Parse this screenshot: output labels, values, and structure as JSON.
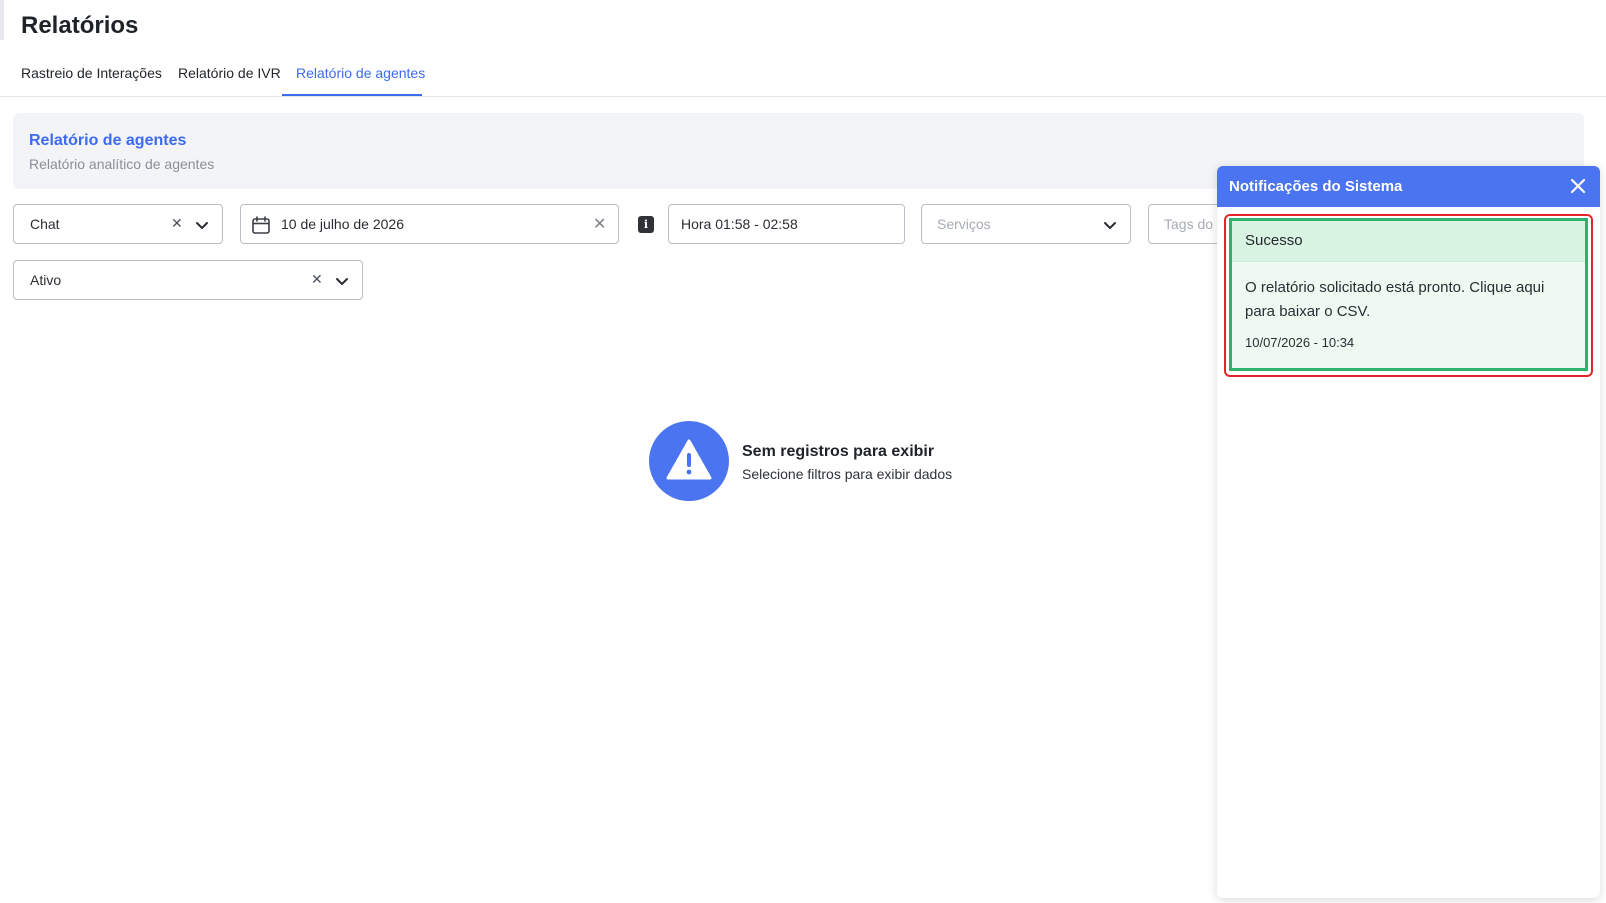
{
  "page": {
    "title": "Relatórios"
  },
  "tabs": [
    {
      "label": "Rastreio de Interações",
      "active": false
    },
    {
      "label": "Relatório de IVR",
      "active": false
    },
    {
      "label": "Relatório de agentes",
      "active": true
    }
  ],
  "banner": {
    "title": "Relatório de agentes",
    "subtitle": "Relatório analítico de agentes"
  },
  "filters": {
    "channel": {
      "value": "Chat"
    },
    "date": {
      "value": "10 de julho de 2026"
    },
    "hour": {
      "value": "Hora 01:58 - 02:58"
    },
    "services": {
      "placeholder": "Serviços"
    },
    "tags": {
      "placeholder": "Tags do"
    },
    "status": {
      "value": "Ativo"
    }
  },
  "empty_state": {
    "title": "Sem registros para exibir",
    "subtitle": "Selecione filtros para exibir dados"
  },
  "notifications": {
    "title": "Notificações do Sistema",
    "items": [
      {
        "status": "Sucesso",
        "message": "O relatório solicitado está pronto. Clique aqui para baixar o CSV.",
        "timestamp": "10/07/2026 - 10:34"
      }
    ]
  },
  "colors": {
    "accent": "#3d6af0",
    "success_border": "#2fb26b",
    "success_bg": "#eef9f2",
    "highlight": "#e5242b"
  },
  "icons": {
    "close": "close-icon",
    "calendar": "calendar-icon",
    "chevron": "chevron-down-icon",
    "clear": "clear-icon",
    "info": "info-icon",
    "warning": "warning-icon"
  }
}
